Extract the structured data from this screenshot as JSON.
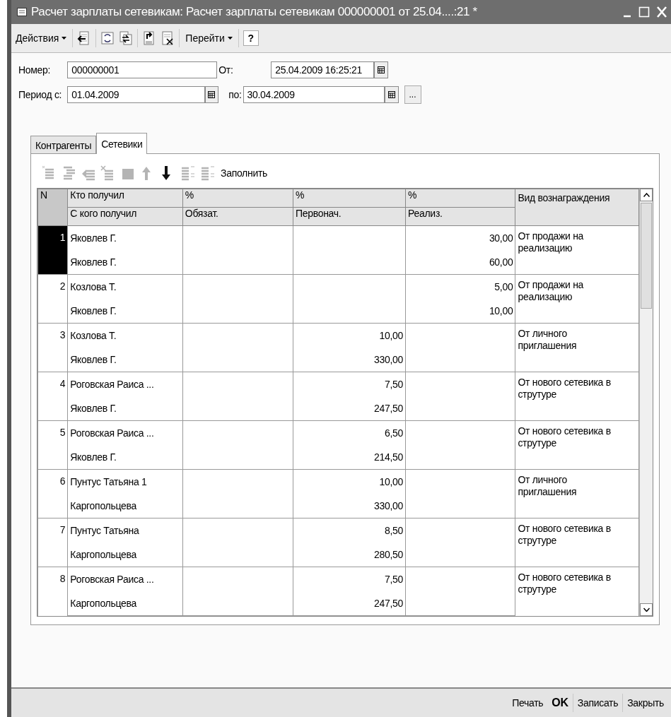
{
  "window": {
    "title": "Расчет зарплаты сетевикам: Расчет зарплаты сетевикам 000000001 от 25.04....:21 *"
  },
  "toolbar": {
    "actions_menu": "Действия",
    "goto_menu": "Перейти",
    "help": "?",
    "icons": [
      {
        "kind": "doc-arrow"
      },
      {
        "kind": "refresh"
      },
      {
        "kind": "copy"
      },
      {
        "kind": "doc-up"
      },
      {
        "kind": "doc-delete"
      }
    ]
  },
  "form": {
    "number_label": "Номер:",
    "number": "000000001",
    "date_label": "От:",
    "date": "25.04.2009 16:25:21",
    "period_label": "Период с:",
    "period_from": "01.04.2009",
    "period_to_label": "по:",
    "period_to": "30.04.2009",
    "period_button": "..."
  },
  "tabs": [
    {
      "label": "Контрагенты",
      "selected": false
    },
    {
      "label": "Сетевики",
      "selected": true
    }
  ],
  "table_toolbar": {
    "icons": [
      {
        "kind": "list-plus",
        "disabled": true
      },
      {
        "kind": "list-indent",
        "disabled": true
      },
      {
        "kind": "list-arrow",
        "disabled": true
      },
      {
        "kind": "list-delete",
        "disabled": true
      },
      {
        "kind": "grid",
        "disabled": true
      },
      {
        "kind": "arrow-up",
        "disabled": true
      },
      {
        "kind": "arrow-down",
        "disabled": false
      },
      {
        "kind": "sort-asc",
        "disabled": true
      },
      {
        "kind": "sort-desc",
        "disabled": true
      }
    ],
    "fill_button": "Заполнить"
  },
  "table": {
    "columns": [
      {
        "top": "N"
      },
      {
        "top": "Кто получил",
        "bottom": "С кого получил"
      },
      {
        "top": "%",
        "bottom": "Обязат."
      },
      {
        "top": "%",
        "bottom": "Первонач."
      },
      {
        "top": "%",
        "bottom": "Реализ."
      },
      {
        "top": "Вид вознаграждения"
      }
    ],
    "rows": [
      {
        "number": "1",
        "selected": true,
        "who_received": "Яковлев Г.",
        "from_whom": "Яковлев Г.",
        "realized": [
          "30,00",
          "60,00"
        ],
        "reward": "От продажи на реализацию"
      },
      {
        "number": "2",
        "selected": false,
        "who_received": "Козлова Т.",
        "from_whom": "Яковлев Г.",
        "realized": [
          "5,00",
          "10,00"
        ],
        "reward": "От продажи на реализацию"
      },
      {
        "number": "3",
        "selected": false,
        "who_received": "Козлова Т.",
        "from_whom": "Яковлев Г.",
        "initial": [
          "10,00",
          "330,00"
        ],
        "reward": "От личного приглашения"
      },
      {
        "number": "4",
        "selected": false,
        "who_received": "Роговская Раиса ...",
        "from_whom": "Яковлев Г.",
        "initial": [
          "7,50",
          "247,50"
        ],
        "reward": "От нового сетевика в струтуре"
      },
      {
        "number": "5",
        "selected": false,
        "who_received": "Роговская Раиса ...",
        "from_whom": "Яковлев Г.",
        "initial": [
          "6,50",
          "214,50"
        ],
        "reward": "От нового сетевика в струтуре"
      },
      {
        "number": "6",
        "selected": false,
        "who_received": "Пунтус Татьяна 1",
        "from_whom": "Каргопольцева",
        "initial": [
          "10,00",
          "330,00"
        ],
        "reward": "От личного приглашения"
      },
      {
        "number": "7",
        "selected": false,
        "who_received": "Пунтус Татьяна",
        "from_whom": "Каргопольцева",
        "initial": [
          "8,50",
          "280,50"
        ],
        "reward": "От нового сетевика в струтуре"
      },
      {
        "number": "8",
        "selected": false,
        "who_received": "Роговская Раиса ...",
        "from_whom": "Каргопольцева",
        "initial": [
          "7,50",
          "247,50"
        ],
        "reward": "От нового сетевика в струтуре"
      }
    ]
  },
  "footer": {
    "buttons": [
      {
        "label": "Печать",
        "default": false
      },
      {
        "label": "OK",
        "default": true
      },
      {
        "label": "Записать",
        "default": false
      },
      {
        "label": "Закрыть",
        "default": false
      }
    ]
  }
}
